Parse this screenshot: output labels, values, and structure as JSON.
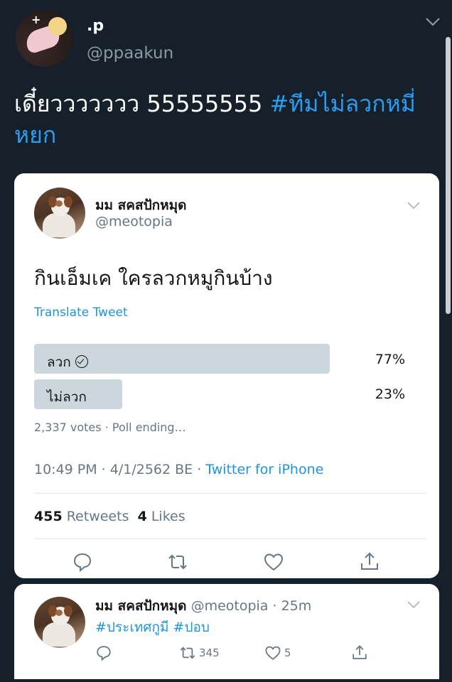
{
  "tweet": {
    "author_name": ".p",
    "author_handle": "@ppaakun",
    "text_main": "เดี๋ยววววววว 55555555 ",
    "hashtag": "#ทีมไม่ลวกหมี่หยก"
  },
  "quoted": {
    "author_name": "มม สคสปักหมุด",
    "author_handle": "@meotopia",
    "text": "กินเอ็มเค ใครลวกหมูกินบ้าง",
    "translate_label": "Translate Tweet",
    "poll": {
      "options": [
        {
          "label": "ลวก",
          "percent_label": "77%",
          "percent": 77,
          "selected": true
        },
        {
          "label": "ไม่ลวก",
          "percent_label": "23%",
          "percent": 23,
          "selected": false
        }
      ],
      "meta": "2,337 votes · Poll ending…"
    },
    "time": "10:49 PM · 4/1/2562 BE · ",
    "source": "Twitter for iPhone",
    "retweets_count": "455",
    "retweets_label": " Retweets",
    "likes_count": "4",
    "likes_label": " Likes"
  },
  "reply": {
    "author_name": "มม สคสปักหมุด",
    "author_handle": " @meotopia",
    "time": " · 25m",
    "hashtags": "#ประเทศกูมี #ปอบ",
    "retweet_count": "345",
    "like_count": "5"
  },
  "icons": [
    "chevron-down-icon",
    "reply-icon",
    "retweet-icon",
    "like-icon",
    "share-icon",
    "check-circle-icon"
  ],
  "colors": {
    "background": "#16202b",
    "accent": "#1b95e0",
    "hashtag_dark": "#2b9df0",
    "poll_bar": "#ccd6dd"
  }
}
